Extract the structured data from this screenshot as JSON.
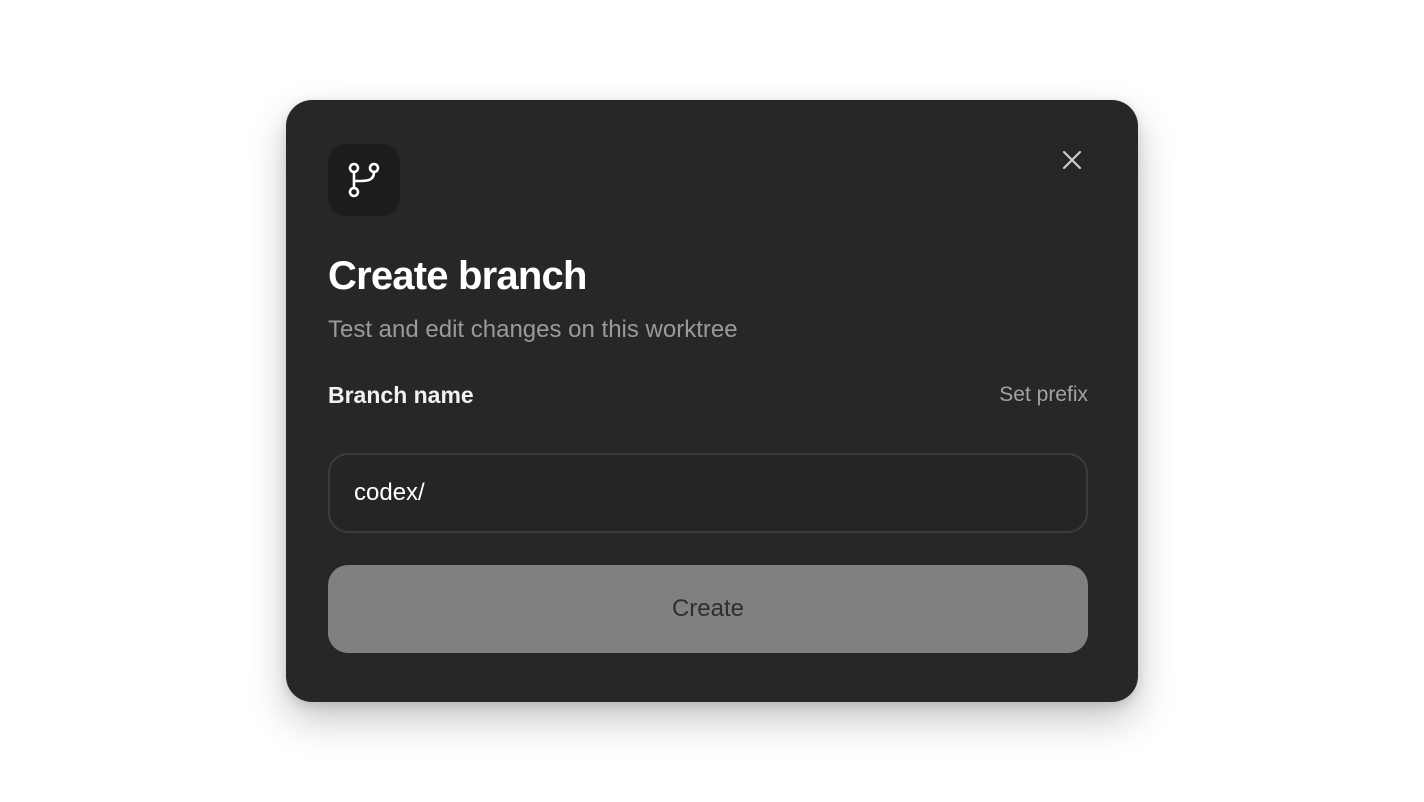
{
  "dialog": {
    "icon": "git-branch-icon",
    "close_icon": "close-icon",
    "title": "Create branch",
    "subtitle": "Test and edit changes on this worktree",
    "field_label": "Branch name",
    "set_prefix_label": "Set prefix",
    "branch_input": {
      "value": "codex/",
      "placeholder": ""
    },
    "create_label": "Create"
  },
  "colors": {
    "dialog_background": "#272727",
    "icon_tile": "#1c1c1c",
    "title_text": "#ffffff",
    "muted_text": "#9a9a9a",
    "input_border": "#3c3c3c",
    "create_button_disabled": "#808080"
  }
}
